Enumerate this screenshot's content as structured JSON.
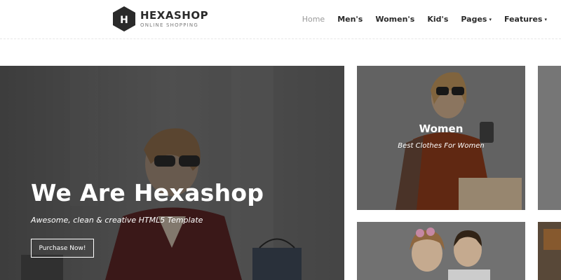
{
  "brand": {
    "logo_letter": "H",
    "title": "HEXASHOP",
    "subtitle": "ONLINE SHOPPING"
  },
  "nav": {
    "items": [
      {
        "label": "Home",
        "active": true
      },
      {
        "label": "Men's"
      },
      {
        "label": "Women's"
      },
      {
        "label": "Kid's"
      },
      {
        "label": "Pages",
        "dropdown": true
      },
      {
        "label": "Features",
        "dropdown": true
      }
    ]
  },
  "hero": {
    "title": "We Are Hexashop",
    "subtitle": "Awesome, clean & creative HTML5 Template",
    "button_label": "Purchase Now!"
  },
  "cards": {
    "women": {
      "title": "Women",
      "subtitle": "Best Clothes For Women"
    }
  },
  "colors": {
    "text_dark": "#2a2a2a",
    "nav_active": "#9a9a9a",
    "overlay": "#000000"
  },
  "icons": {
    "logo": "hexagon-logo-icon",
    "dropdown": "chevron-down-icon"
  }
}
